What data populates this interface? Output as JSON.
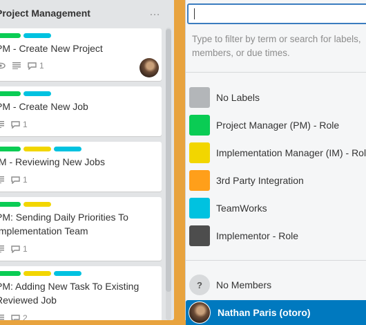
{
  "list": {
    "title": "Project Management",
    "menu_icon": "…",
    "cards": [
      {
        "labels": [
          "#61bd4f_green",
          "#00c2e0_teal"
        ],
        "title_lines": [
          "PM - Create New Project"
        ],
        "badges": {
          "watch": true,
          "description": true,
          "comments": "1"
        },
        "has_avatar": true
      },
      {
        "labels": [
          "green",
          "teal"
        ],
        "title_lines": [
          "PM - Create New Job"
        ],
        "badges": {
          "description": true,
          "comments": "1"
        }
      },
      {
        "labels": [
          "green",
          "yellow",
          "teal"
        ],
        "title_lines": [
          "IM - Reviewing New Jobs"
        ],
        "badges": {
          "description": true,
          "comments": "1"
        }
      },
      {
        "labels": [
          "green",
          "yellow"
        ],
        "title_lines": [
          "PM: Sending Daily Priorities To",
          "Implementation Team"
        ],
        "badges": {
          "description": true,
          "comments": "1"
        }
      },
      {
        "labels": [
          "green",
          "yellow",
          "teal"
        ],
        "title_lines": [
          "PM: Adding New Task To Existing",
          "Reviewed Job"
        ],
        "badges": {
          "description": true,
          "comments": "2"
        }
      }
    ]
  },
  "colors": {
    "green": "#0acc54",
    "yellow": "#f2d600",
    "teal": "#00c2e0",
    "orange": "#ff9f1a",
    "gray": "#b3b6b9",
    "dark": "#4d4d4d",
    "selected_blue": "#0079bf",
    "board_bg": "#e8a33e"
  },
  "popover": {
    "search_value": "",
    "hint": "Type to filter by term or search for labels, members, or due times.",
    "labels": [
      {
        "name": "No Labels",
        "color": "#b3b6b9"
      },
      {
        "name": "Project Manager (PM) - Role",
        "color": "#0acc54"
      },
      {
        "name": "Implementation Manager (IM) - Role",
        "color": "#f2d600"
      },
      {
        "name": "3rd Party Integration",
        "color": "#ff9f1a"
      },
      {
        "name": "TeamWorks",
        "color": "#00c2e0"
      },
      {
        "name": "Implementor - Role",
        "color": "#4d4d4d"
      }
    ],
    "no_members": "No Members",
    "no_members_icon": "?",
    "selected_member": "Nathan Paris (otoro)"
  }
}
